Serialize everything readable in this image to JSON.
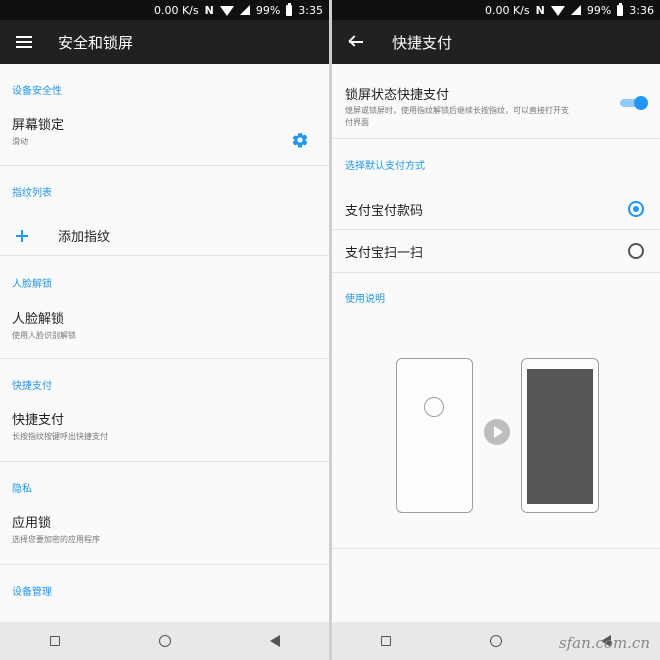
{
  "left": {
    "status": {
      "speed": "0.00 K/s",
      "nfc": "N",
      "battery": "99%",
      "time": "3:35"
    },
    "toolbar": {
      "title": "安全和锁屏",
      "icon": "menu-icon"
    },
    "sections": {
      "device_security": "设备安全性",
      "fingerprint_list": "指纹列表",
      "face_unlock": "人脸解锁",
      "quick_pay": "快捷支付",
      "privacy": "隐私",
      "device_admin": "设备管理"
    },
    "rows": {
      "screen_lock": {
        "title": "屏幕锁定",
        "sub": "滑动"
      },
      "add_fingerprint": {
        "title": "添加指纹"
      },
      "face_unlock": {
        "title": "人脸解锁",
        "sub": "使用人脸识别解锁"
      },
      "quick_pay": {
        "title": "快捷支付",
        "sub": "长按指纹按键呼出快捷支付"
      },
      "app_lock": {
        "title": "应用锁",
        "sub": "选择您要加密的应用程序"
      }
    }
  },
  "right": {
    "status": {
      "speed": "0.00 K/s",
      "nfc": "N",
      "battery": "99%",
      "time": "3:36"
    },
    "toolbar": {
      "title": "快捷支付",
      "icon": "back-arrow-icon"
    },
    "lockscreen_pay": {
      "title": "锁屏状态快捷支付",
      "sub_line1": "熄屏或锁屏时，使用指纹解锁后继续长按指纹，可以直接打开支",
      "sub_line2": "付界面",
      "enabled": true
    },
    "choose_header": "选择默认支付方式",
    "options": [
      {
        "label": "支付宝付款码",
        "selected": true
      },
      {
        "label": "支付宝扫一扫",
        "selected": false
      }
    ],
    "usage_header": "使用说明"
  },
  "watermark": "sfan.com.cn",
  "colors": {
    "accent": "#2196f3",
    "toolbar": "#212121",
    "statusbar": "#101010"
  }
}
